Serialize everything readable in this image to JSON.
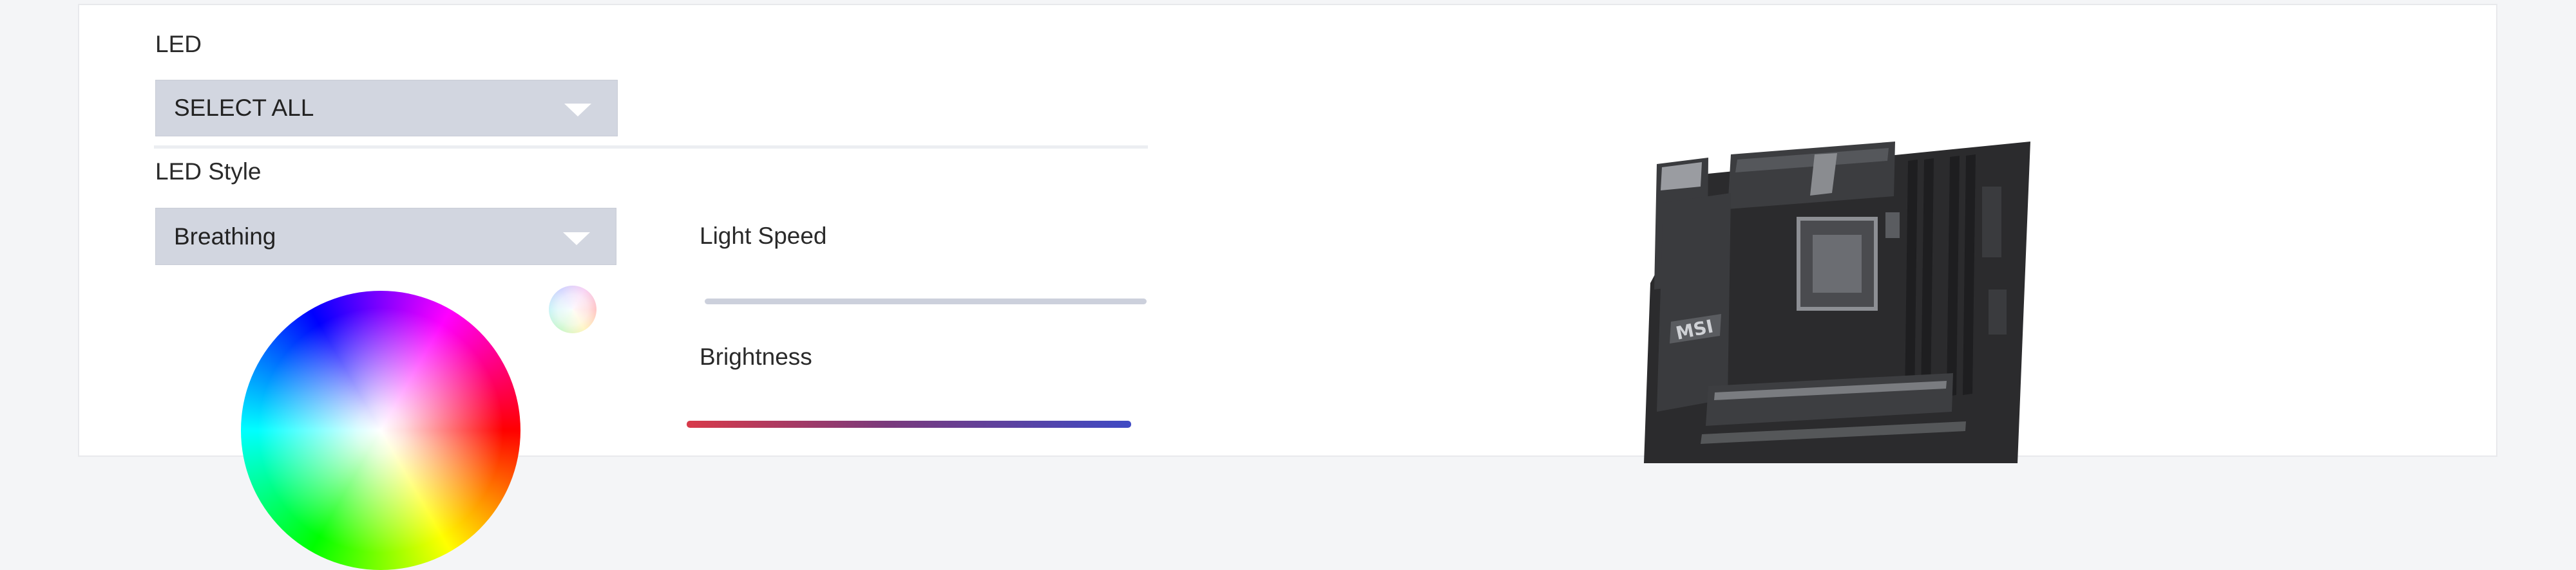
{
  "led_section": {
    "label": "LED",
    "select": {
      "value": "SELECT ALL"
    }
  },
  "led_style_section": {
    "label": "LED Style",
    "select": {
      "value": "Breathing"
    }
  },
  "light_speed": {
    "label": "Light Speed"
  },
  "brightness": {
    "label": "Brightness",
    "value_percent": 100
  },
  "colors": {
    "dropdown_bg": "#d2d6e0",
    "brightness_gradient_start": "#d83a4a",
    "brightness_gradient_end": "#3f4ac4",
    "board_body": "#2b2b2d"
  },
  "icons": {
    "dropdown_caret": "chevron-down-icon",
    "color_preview": "color-swatch-icon"
  }
}
